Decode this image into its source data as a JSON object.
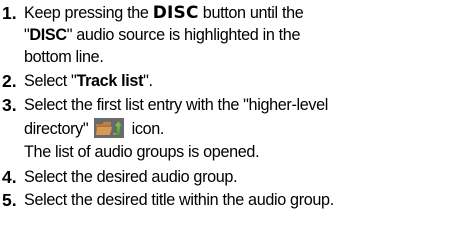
{
  "steps": [
    {
      "number": "1.",
      "line1_pre": "Keep pressing the ",
      "line1_key": "DISC",
      "line1_post": " button until the",
      "line2_pre": "\"",
      "line2_src": "DISC",
      "line2_post": "\" audio source is highlighted in the",
      "line3": "bottom line."
    },
    {
      "number": "2.",
      "pre": "Select \"",
      "bold": "Track list",
      "post": "\"."
    },
    {
      "number": "3.",
      "line1": "Select the first list entry with the \"higher-level",
      "line2_pre": "directory\" ",
      "icon": "folder-up-icon",
      "line2_post": " icon.",
      "line3": "The list of audio groups is opened."
    },
    {
      "number": "4.",
      "text": "Select the desired audio group."
    },
    {
      "number": "5.",
      "text": "Select the desired title within the audio group."
    }
  ]
}
